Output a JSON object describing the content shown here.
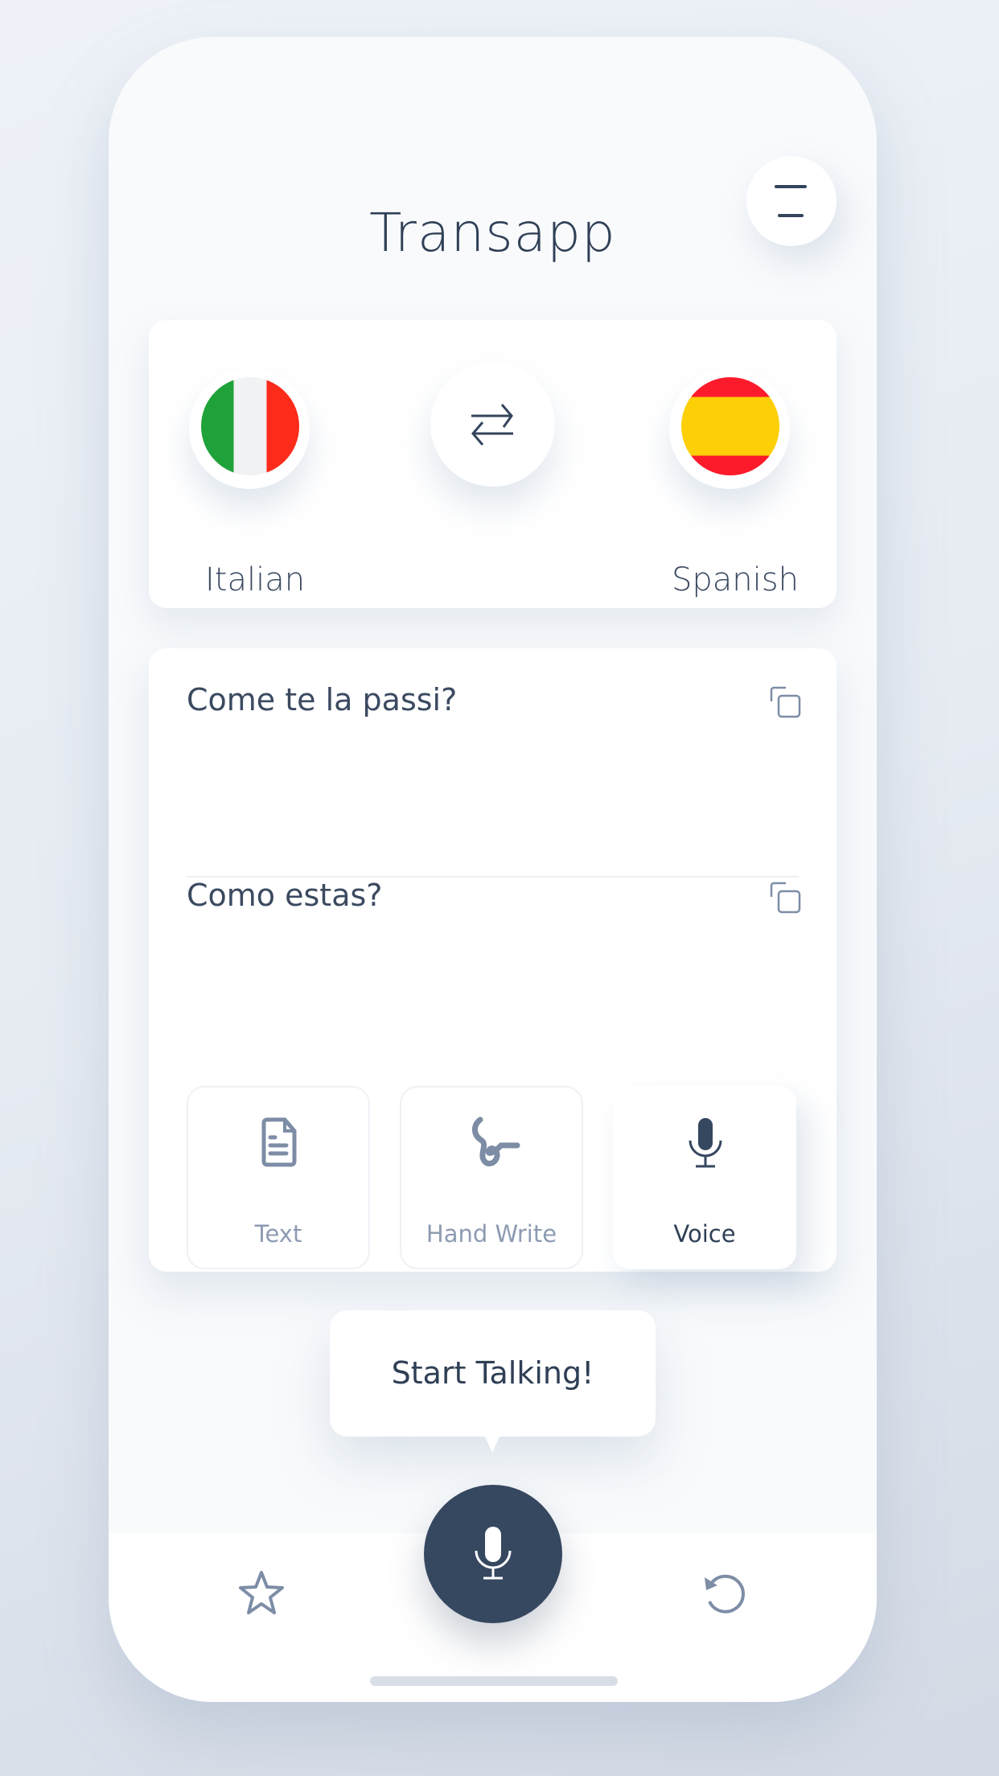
{
  "app": {
    "title": "Transapp"
  },
  "header": {
    "menu_icon": "menu-icon"
  },
  "languages": {
    "source": {
      "name": "Italian",
      "flag": "italy-flag",
      "colors": [
        "#20a23a",
        "#f0f2f3",
        "#fd2b1a"
      ]
    },
    "target": {
      "name": "Spanish",
      "flag": "spain-flag",
      "colors": [
        "#fd1a2a",
        "#fdcf07",
        "#fd1a2a"
      ]
    },
    "swap_icon": "swap-arrows-icon"
  },
  "translation": {
    "source_text": "Come te la passi?",
    "target_text": "Como estas?",
    "copy_icon": "copy-icon"
  },
  "input_modes": [
    {
      "label": "Text",
      "icon": "document-icon",
      "active": false
    },
    {
      "label": "Hand Write",
      "icon": "handwriting-icon",
      "active": false
    },
    {
      "label": "Voice",
      "icon": "microphone-icon",
      "active": true
    }
  ],
  "tooltip": {
    "text": "Start Talking!"
  },
  "bottom_nav": {
    "left_icon": "star-icon",
    "center_icon": "microphone-icon",
    "right_icon": "history-icon"
  },
  "colors": {
    "primary": "#364760",
    "text": "#2f3f55",
    "muted": "#8d9bb2",
    "background": "#f8fafc"
  }
}
